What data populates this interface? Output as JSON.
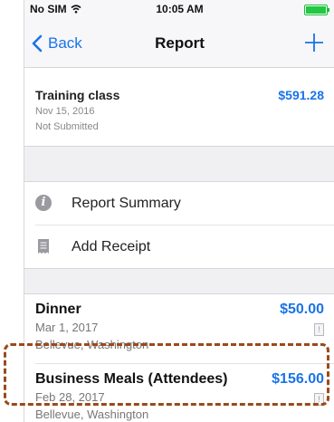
{
  "status_bar": {
    "carrier": "No SIM",
    "time": "10:05 AM"
  },
  "nav": {
    "back_label": "Back",
    "title": "Report",
    "add_symbol": "+"
  },
  "report": {
    "name": "Training class",
    "amount": "$591.28",
    "date": "Nov 15, 2016",
    "status": "Not Submitted"
  },
  "menu": [
    {
      "label": "Report Summary",
      "icon": "info-icon"
    },
    {
      "label": "Add Receipt",
      "icon": "receipt-icon"
    }
  ],
  "expenses": [
    {
      "name": "Dinner",
      "amount": "$50.00",
      "date": "Mar 1, 2017",
      "location": "Bellevue, Washington",
      "flag": "!"
    },
    {
      "name": "Business Meals (Attendees)",
      "amount": "$156.00",
      "date": "Feb 28, 2017",
      "location": "Bellevue, Washington",
      "flag": "!"
    }
  ],
  "colors": {
    "accent": "#1a73e8",
    "highlight_border": "#9a4a1c",
    "battery": "#22c83f"
  }
}
